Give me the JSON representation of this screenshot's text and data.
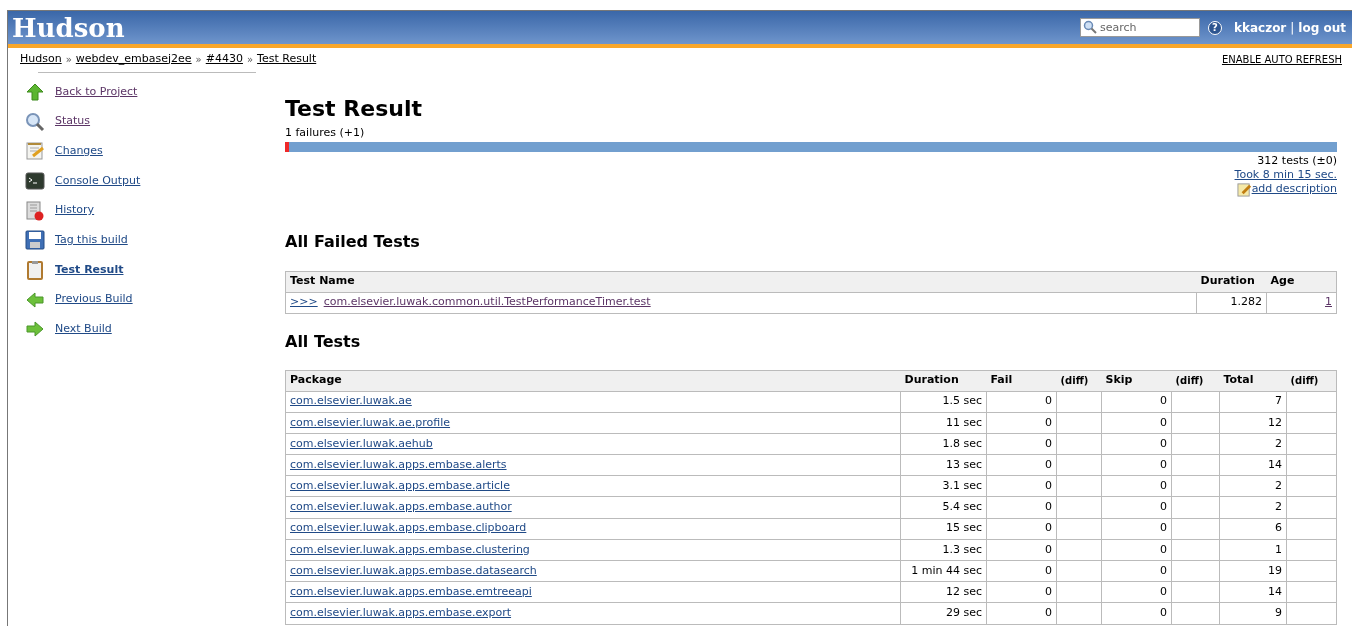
{
  "header": {
    "logo": "Hudson",
    "search": {
      "placeholder": "search"
    },
    "help": "?",
    "user": "kkaczor",
    "separator": "|",
    "logout": "log out"
  },
  "breadcrumbs": [
    {
      "label": "Hudson"
    },
    {
      "label": "webdev_embasej2ee"
    },
    {
      "label": "#4430"
    },
    {
      "label": "Test Result"
    }
  ],
  "breadcrumb_separator": "»",
  "auto_refresh": "ENABLE AUTO REFRESH",
  "sidebar": {
    "items": [
      {
        "label": "Back to Project",
        "kind": "up",
        "visited": true,
        "selected": false
      },
      {
        "label": "Status",
        "kind": "search",
        "visited": true,
        "selected": false
      },
      {
        "label": "Changes",
        "kind": "notepad",
        "visited": false,
        "selected": false
      },
      {
        "label": "Console Output",
        "kind": "terminal",
        "visited": false,
        "selected": false
      },
      {
        "label": "History",
        "kind": "history",
        "visited": false,
        "selected": false
      },
      {
        "label": "Tag this build",
        "kind": "save",
        "visited": false,
        "selected": false
      },
      {
        "label": "Test Result",
        "kind": "clipboard",
        "visited": false,
        "selected": true
      },
      {
        "label": "Previous Build",
        "kind": "left",
        "visited": false,
        "selected": false
      },
      {
        "label": "Next Build",
        "kind": "right",
        "visited": false,
        "selected": false
      }
    ]
  },
  "title": "Test Result",
  "failures": "1 failures (+1)",
  "failure_bar": {
    "level": 0.004
  },
  "tests_count": "312 tests (±0)",
  "took": "Took 8 min 15 sec.",
  "add_description": "add description",
  "failed_section": {
    "title": "All Failed Tests",
    "columns": [
      "Test Name",
      "Duration",
      "Age"
    ],
    "rows": [
      {
        "expander": ">>>",
        "name": "com.elsevier.luwak.common.util.TestPerformanceTimer.test",
        "duration": "1.282",
        "age": "1"
      }
    ]
  },
  "all_section": {
    "title": "All Tests",
    "columns": [
      "Package",
      "Duration",
      "Fail",
      "(diff)",
      "Skip",
      "(diff)",
      "Total",
      "(diff)"
    ],
    "rows": [
      {
        "package": "com.elsevier.luwak.ae",
        "duration": "1.5 sec",
        "fail": "0",
        "skip": "0",
        "total": "7"
      },
      {
        "package": "com.elsevier.luwak.ae.profile",
        "duration": "11 sec",
        "fail": "0",
        "skip": "0",
        "total": "12"
      },
      {
        "package": "com.elsevier.luwak.aehub",
        "duration": "1.8 sec",
        "fail": "0",
        "skip": "0",
        "total": "2"
      },
      {
        "package": "com.elsevier.luwak.apps.embase.alerts",
        "duration": "13 sec",
        "fail": "0",
        "skip": "0",
        "total": "14"
      },
      {
        "package": "com.elsevier.luwak.apps.embase.article",
        "duration": "3.1 sec",
        "fail": "0",
        "skip": "0",
        "total": "2"
      },
      {
        "package": "com.elsevier.luwak.apps.embase.author",
        "duration": "5.4 sec",
        "fail": "0",
        "skip": "0",
        "total": "2"
      },
      {
        "package": "com.elsevier.luwak.apps.embase.clipboard",
        "duration": "15 sec",
        "fail": "0",
        "skip": "0",
        "total": "6"
      },
      {
        "package": "com.elsevier.luwak.apps.embase.clustering",
        "duration": "1.3 sec",
        "fail": "0",
        "skip": "0",
        "total": "1"
      },
      {
        "package": "com.elsevier.luwak.apps.embase.datasearch",
        "duration": "1 min 44 sec",
        "fail": "0",
        "skip": "0",
        "total": "19"
      },
      {
        "package": "com.elsevier.luwak.apps.embase.emtreeapi",
        "duration": "12 sec",
        "fail": "0",
        "skip": "0",
        "total": "14"
      },
      {
        "package": "com.elsevier.luwak.apps.embase.export",
        "duration": "29 sec",
        "fail": "0",
        "skip": "0",
        "total": "9"
      }
    ]
  }
}
